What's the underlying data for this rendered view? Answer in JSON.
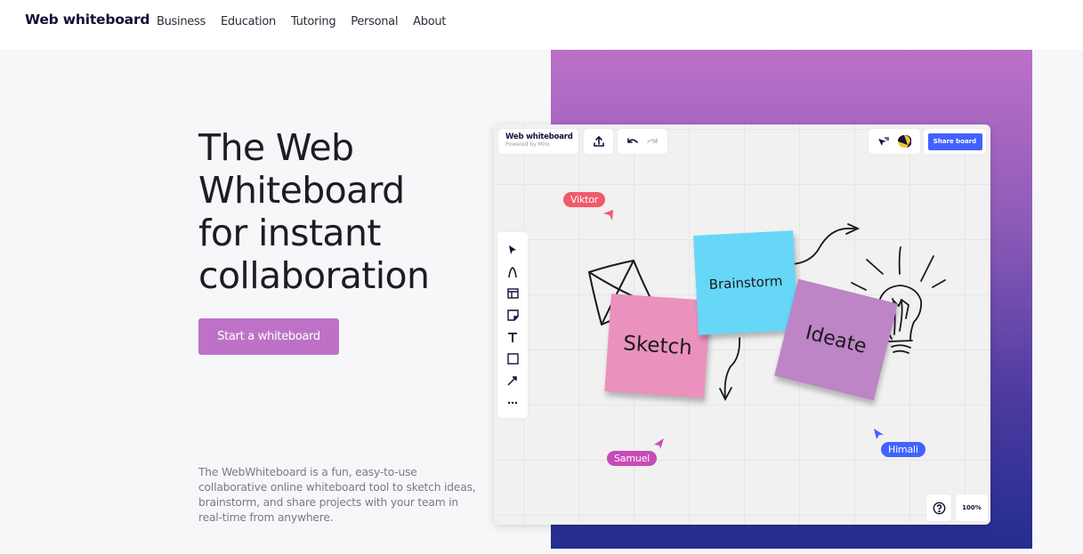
{
  "nav": {
    "brand": "Web whiteboard",
    "links": [
      "Business",
      "Education",
      "Tutoring",
      "Personal",
      "About"
    ]
  },
  "hero": {
    "title_lines": [
      "The Web",
      "Whiteboard",
      "for instant",
      "collaboration"
    ],
    "cta_label": "Start a whiteboard",
    "description": "The WebWhiteboard is a fun, easy-to-use collaborative online whiteboard tool to sketch ideas, brainstorm, and share projects with your team in real-time from anywhere."
  },
  "board": {
    "title": "Web whiteboard",
    "subtitle": "Powered by Miro",
    "share_label": "Share board",
    "zoom_level": "100%",
    "tools": [
      "select-icon",
      "pen-icon",
      "template-icon",
      "sticky-note-icon",
      "text-icon",
      "shape-icon",
      "arrow-icon",
      "more-icon"
    ],
    "stickies": {
      "sketch": "Sketch",
      "brainstorm": "Brainstorm",
      "ideate": "Ideate"
    },
    "collaborators": [
      {
        "name": "Viktor",
        "color": "#f05a6a"
      },
      {
        "name": "Samuel",
        "color": "#c74bb8"
      },
      {
        "name": "Himali",
        "color": "#4262ff"
      }
    ]
  },
  "colors": {
    "accent": "#bd72c7",
    "share_blue": "#4262ff",
    "gradient_top": "#bc70c8",
    "gradient_bottom": "#232d8e"
  }
}
